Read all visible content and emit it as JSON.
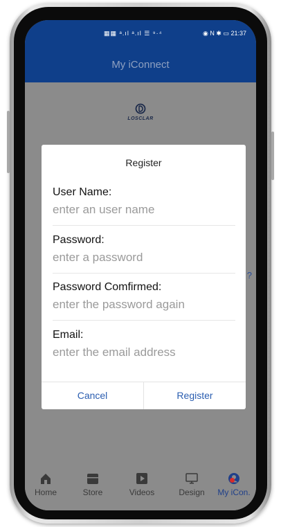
{
  "status_bar": {
    "left_icons": "▦▦ ᵃ.ıl ᵃ.ıl ☰ ⁹·⁴",
    "right_icons": "◉ N ✱ ▭",
    "time": "21:37"
  },
  "app": {
    "title": "My iConnect",
    "logo_text": "LOSCLAR"
  },
  "background": {
    "help_char": "?"
  },
  "dialog": {
    "title": "Register",
    "fields": [
      {
        "label": "User Name:",
        "placeholder": "enter an user name"
      },
      {
        "label": "Password:",
        "placeholder": "enter a password"
      },
      {
        "label": "Password Comfirmed:",
        "placeholder": "enter the password again"
      },
      {
        "label": "Email:",
        "placeholder": "enter the email address"
      }
    ],
    "cancel": "Cancel",
    "register": "Register"
  },
  "tabs": [
    {
      "label": "Home",
      "icon": "home-icon"
    },
    {
      "label": "Store",
      "icon": "store-icon"
    },
    {
      "label": "Videos",
      "icon": "play-icon"
    },
    {
      "label": "Design",
      "icon": "monitor-icon"
    },
    {
      "label": "My iCon.",
      "icon": "user-icon",
      "active": true
    }
  ],
  "colors": {
    "brand": "#0f3f8a",
    "accent": "#2a5db0",
    "badge": "#d62b2b"
  }
}
